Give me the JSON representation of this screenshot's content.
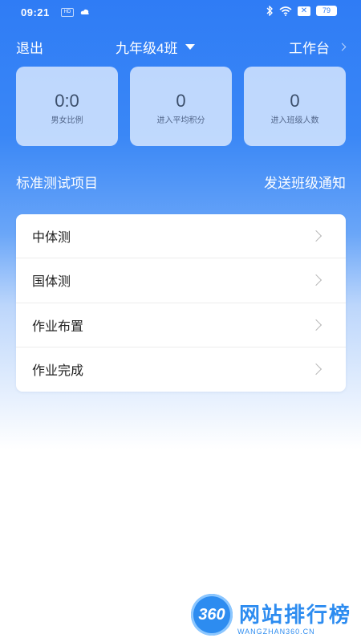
{
  "status_bar": {
    "time": "09:21",
    "hd_badge": "HD",
    "battery": "79",
    "icons": [
      "cloud-icon",
      "bluetooth-icon",
      "wifi-icon",
      "x-badge-icon",
      "battery-icon"
    ]
  },
  "header": {
    "logout_label": "退出",
    "class_name": "九年级4班",
    "workbench_label": "工作台"
  },
  "stats": [
    {
      "value": "0:0",
      "label": "男女比例"
    },
    {
      "value": "0",
      "label": "进入平均积分"
    },
    {
      "value": "0",
      "label": "进入班级人数"
    }
  ],
  "section": {
    "title": "标准测试项目",
    "send_notice_label": "发送班级通知"
  },
  "menu": {
    "items": [
      {
        "label": "中体测"
      },
      {
        "label": "国体测"
      },
      {
        "label": "作业布置"
      },
      {
        "label": "作业完成"
      }
    ]
  },
  "watermark": {
    "logo_text": "360",
    "title": "网站排行榜",
    "subtitle": "WANGZHAN360.CN"
  },
  "colors": {
    "primary_blue": "#2f7cf5",
    "watermark_blue": "#2d8cf0"
  }
}
